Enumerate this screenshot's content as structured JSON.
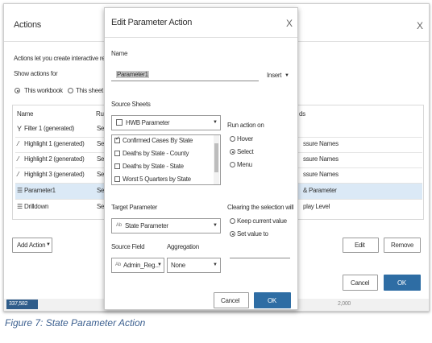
{
  "actions_dialog": {
    "title": "Actions",
    "close_glyph": "X",
    "description": "Actions let you create interactive relations",
    "show_actions_label": "Show actions for",
    "scope_options": [
      "This workbook",
      "This sheet"
    ],
    "selected_scope": "This workbook",
    "columns": {
      "name": "Name",
      "run_on_abbrev": "Ru",
      "fields_abbrev": "ds"
    },
    "rows": [
      {
        "name": "Filter 1 (generated)",
        "icon": "filter-icon",
        "run": "Se",
        "fields": "",
        "selected": false
      },
      {
        "name": "Highlight 1 (generated)",
        "icon": "highlight-icon",
        "run": "Se",
        "fields": "ssure Names",
        "selected": false
      },
      {
        "name": "Highlight 2 (generated)",
        "icon": "highlight-icon",
        "run": "Se",
        "fields": "ssure Names",
        "selected": false
      },
      {
        "name": "Highlight 3 (generated)",
        "icon": "highlight-icon",
        "run": "Se",
        "fields": "ssure Names",
        "selected": false
      },
      {
        "name": "Parameter1",
        "icon": "parameter-icon",
        "run": "Se",
        "fields": "& Parameter",
        "selected": true
      },
      {
        "name": "Drilldown",
        "icon": "parameter-icon",
        "run": "Se",
        "fields": "play Level",
        "selected": false
      }
    ],
    "add_action_label": "Add Action",
    "edit_label": "Edit",
    "remove_label": "Remove",
    "cancel_label": "Cancel",
    "ok_label": "OK",
    "footer_left": "337,582",
    "footer_right": "2,000"
  },
  "edit_dialog": {
    "title": "Edit Parameter Action",
    "close_glyph": "X",
    "name_label": "Name",
    "name_value": "Parameter1",
    "insert_label": "Insert",
    "source_sheets_label": "Source Sheets",
    "source_sheet_selected": "HWB Parameter",
    "sheet_list": [
      {
        "label": "Confirmed Cases By State",
        "checked": true
      },
      {
        "label": "Deaths by State - County",
        "checked": false
      },
      {
        "label": "Deaths by State - State",
        "checked": false
      },
      {
        "label": "Worst 5 Quarters by State",
        "checked": false
      }
    ],
    "run_action_on_label": "Run action on",
    "run_options": [
      "Hover",
      "Select",
      "Menu"
    ],
    "run_selected": "Select",
    "target_parameter_label": "Target Parameter",
    "target_parameter_value": "State Parameter",
    "clearing_label": "Clearing the selection will",
    "clearing_options": [
      "Keep current value",
      "Set value to"
    ],
    "clearing_selected": "Set value to",
    "source_field_label": "Source Field",
    "source_field_value": "Admin_Reg...",
    "aggregation_label": "Aggregation",
    "aggregation_value": "None",
    "cancel_label": "Cancel",
    "ok_label": "OK"
  },
  "caption": "Figure 7: State Parameter Action",
  "colors": {
    "accent": "#2e6da4",
    "selected_row": "#dbe9f6",
    "caption": "#3b5f8f"
  }
}
